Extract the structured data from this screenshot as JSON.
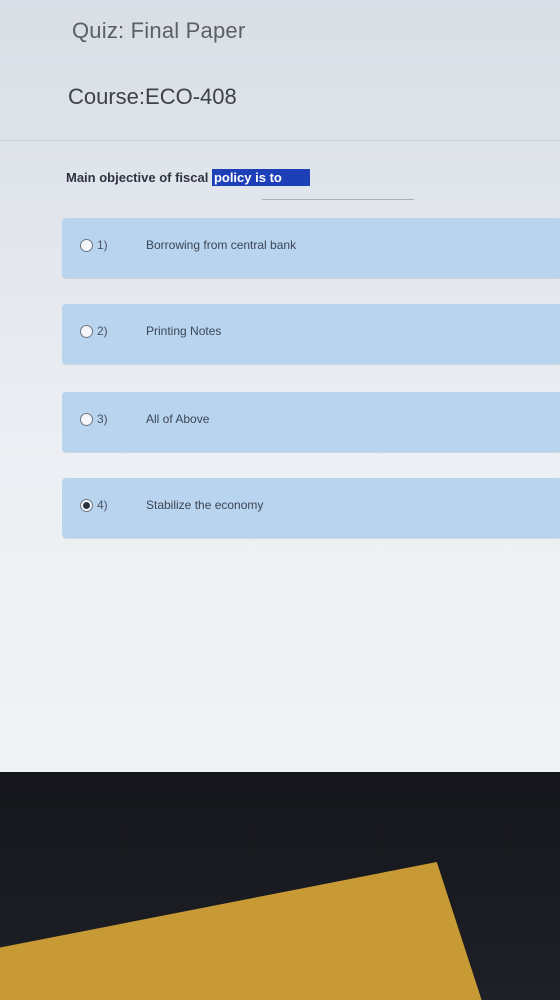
{
  "quiz": {
    "title": "Quiz: Final Paper",
    "course": "Course:ECO-408",
    "question_prefix": "Main objective of fiscal ",
    "question_highlight": "policy is to"
  },
  "options": [
    {
      "number": "1)",
      "text": "Borrowing from central bank",
      "selected": false
    },
    {
      "number": "2)",
      "text": "Printing Notes",
      "selected": false
    },
    {
      "number": "3)",
      "text": "All of Above",
      "selected": false
    },
    {
      "number": "4)",
      "text": "Stabilize the economy",
      "selected": true
    }
  ],
  "colors": {
    "option_bg": "#b8d4ee",
    "highlight": "#1d3fb8"
  }
}
